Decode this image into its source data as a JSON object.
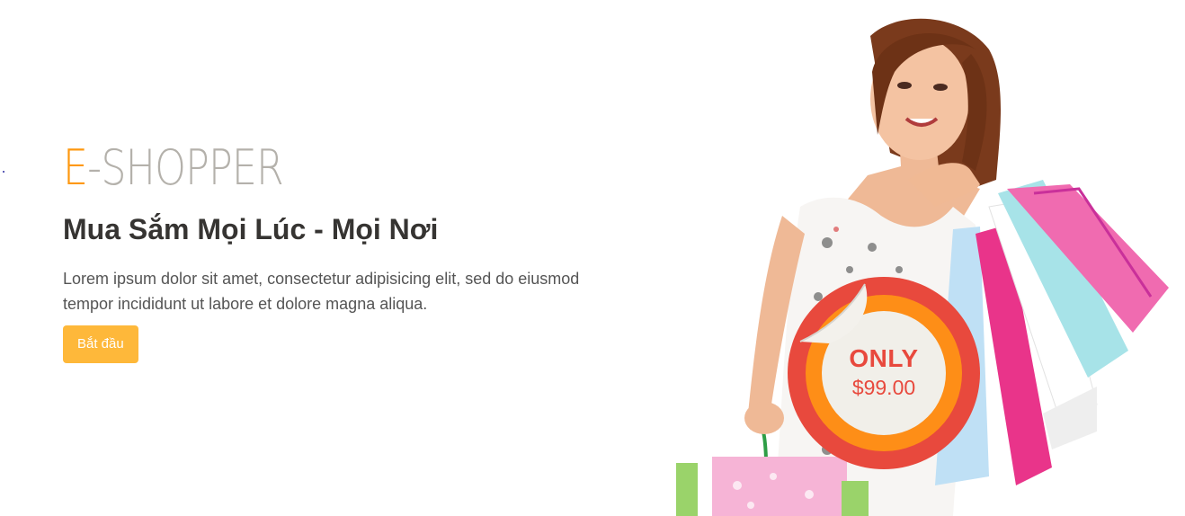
{
  "slide": {
    "brand_accent": "E",
    "brand_rest": "-SHOPPER",
    "tagline": "Mua Sắm Mọi Lúc - Mọi Nơi",
    "description": "Lorem ipsum dolor sit amet, consectetur adipisicing elit, sed do eiusmod tempor incididunt ut labore et dolore magna aliqua.",
    "cta_label": "Bắt đầu"
  },
  "badge": {
    "label": "ONLY",
    "price": "$99.00"
  },
  "colors": {
    "accent": "#fe980f",
    "brand_gray": "#b4b1ab",
    "button": "#feb83a",
    "badge_red": "#e8493d",
    "badge_orange": "#fe8e17"
  }
}
